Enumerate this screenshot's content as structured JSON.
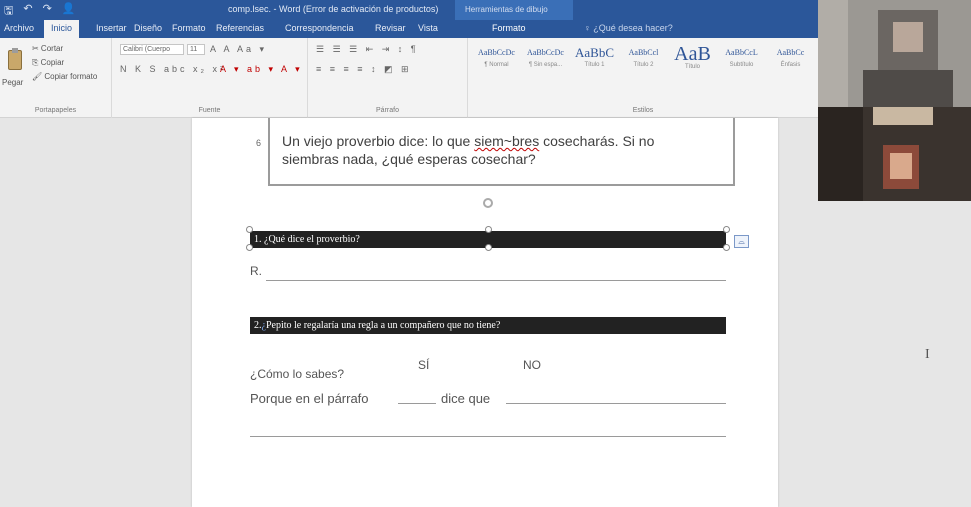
{
  "titlebar": {
    "save_glyph": "🖫",
    "undo_glyph": "↶",
    "redo_glyph": "↷",
    "user_glyph": "👤",
    "title": "comp.lsec. - Word (Error de activación de productos)",
    "drawing_tools": "Herramientas de dibujo"
  },
  "tabs": {
    "archivo": "Archivo",
    "inicio": "Inicio",
    "insertar": "Insertar",
    "diseno": "Diseño",
    "formato1": "Formato",
    "referencias": "Referencias",
    "correspondencia": "Correspondencia",
    "revisar": "Revisar",
    "vista": "Vista",
    "formato2": "Formato",
    "tellme": "♀ ¿Qué desea hacer?"
  },
  "ribbon": {
    "clipboard": {
      "paste": "Pegar",
      "cut": "✂ Cortar",
      "copy": "⎘ Copiar",
      "format_painter": "🖌 Copiar formato",
      "label": "Portapapeles"
    },
    "font": {
      "family": "Calibri (Cuerpo",
      "size": "11",
      "row1": "A A Aa ▾",
      "row2": "N K S abc x₂ x²",
      "row2b": "A ▾ ab ▾ A ▾",
      "label": "Fuente"
    },
    "paragraph": {
      "row1": "☰ ☰ ☰ ⇤ ⇥ ↕ ¶",
      "row2": "≡ ≡ ≡ ≡ ↕ ◩ ⊞",
      "label": "Párrafo"
    },
    "styles": {
      "items": [
        {
          "sample": "AaBbCcDc",
          "name": "¶ Normal"
        },
        {
          "sample": "AaBbCcDc",
          "name": "¶ Sin espa..."
        },
        {
          "sample": "AaBbC",
          "name": "Título 1"
        },
        {
          "sample": "AaBbCcl",
          "name": "Título 2"
        },
        {
          "sample": "AaB",
          "name": "Título"
        },
        {
          "sample": "AaBbCcL",
          "name": "Subtítulo"
        },
        {
          "sample": "AaBbCc",
          "name": "Énfasis"
        }
      ],
      "label": "Estilos"
    }
  },
  "document": {
    "item_number": "6",
    "proverb_before": "Un viejo proverbio dice: lo que ",
    "proverb_squiggle": "siem~bres",
    "proverb_after": " cosecharás. Si no siembras nada, ¿qué esperas cosechar?",
    "q1": "1. ¿Qué dice el proverbio?",
    "answer_label": "R.",
    "q2_num": "2.",
    "q2_mark": "¿",
    "q2_text": "Pepito le regalaría una regla a un compañero que no tiene?",
    "yes": "SÍ",
    "no": "NO",
    "how_know": "¿Cómo lo sabes?",
    "because_prefix": "Porque en el párrafo",
    "because_mid": "dice que",
    "layout_icon": "⌓",
    "ibeam": "I"
  },
  "colors": {
    "word_blue": "#2b579a",
    "question_bar": "#222222",
    "squiggle": "#c00000"
  }
}
